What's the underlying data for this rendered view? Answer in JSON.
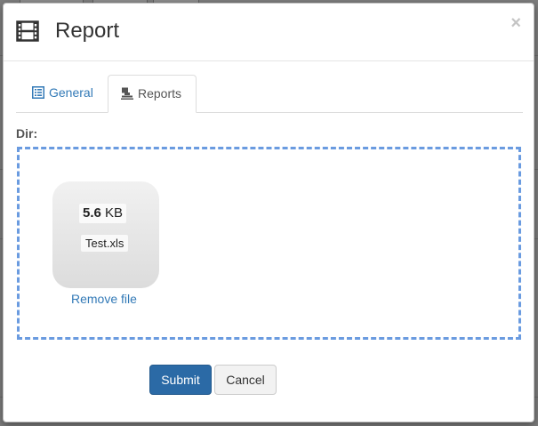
{
  "dialog": {
    "title": "Report",
    "close_glyph": "×",
    "title_icon": "film-icon"
  },
  "tabs": [
    {
      "label": "General",
      "icon": "list-alt-icon",
      "active": false
    },
    {
      "label": "Reports",
      "icon": "stamp-icon",
      "active": true
    }
  ],
  "form": {
    "dir_label": "Dir:"
  },
  "dropzone": {
    "file": {
      "size_value": "5.6",
      "size_unit": " KB",
      "name": "Test.xls"
    },
    "remove_label": "Remove file"
  },
  "buttons": {
    "submit_label": "Submit",
    "cancel_label": "Cancel"
  },
  "colors": {
    "primary": "#337ab7",
    "submit_bg": "#2b6aa6",
    "dropzone_border": "#6a9be0"
  }
}
